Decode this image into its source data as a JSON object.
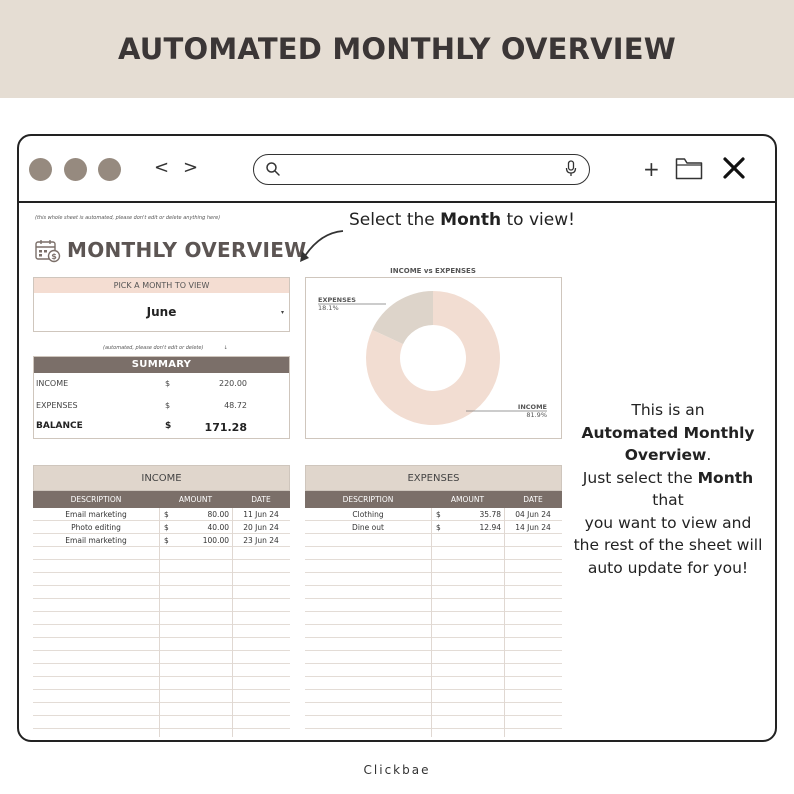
{
  "banner": {
    "title": "AUTOMATED MONTHLY OVERVIEW"
  },
  "browser": {
    "back_label": "<",
    "forward_label": ">",
    "plus_label": "+",
    "search_placeholder": ""
  },
  "sheet": {
    "automated_note": "(this whole sheet is automated, please don't edit or delete anything here)",
    "title": "MONTHLY OVERVIEW",
    "callout": {
      "pre": "Select the ",
      "bold": "Month",
      "post": " to view!"
    },
    "picker": {
      "label": "PICK A MONTH TO VIEW",
      "value": "June",
      "caret": "▾"
    },
    "summary_note": "(automated, please don't edit or delete)",
    "summary_note_arrow": "↓",
    "summary": {
      "title": "SUMMARY",
      "rows": [
        {
          "label": "INCOME",
          "currency": "$",
          "value": "220.00"
        },
        {
          "label": "EXPENSES",
          "currency": "$",
          "value": "48.72"
        },
        {
          "label": "BALANCE",
          "currency": "$",
          "value": "171.28"
        }
      ]
    }
  },
  "chart_data": {
    "type": "pie",
    "title": "INCOME vs EXPENSES",
    "labels": [
      "INCOME",
      "EXPENSES"
    ],
    "values": [
      81.9,
      18.1
    ],
    "value_labels": [
      "81.9%",
      "18.1%"
    ],
    "colors": [
      "#f2ddd2",
      "#ddd4ca"
    ],
    "donut": true
  },
  "right_text": {
    "line1": "This is an",
    "line2": "Automated Monthly",
    "line3": "Overview",
    "line3_end": ".",
    "line4_pre": "Just select the ",
    "line4_bold": "Month",
    "line4_post": " that",
    "line5": "you want to view and",
    "line6": "the rest of the sheet will",
    "line7": "auto update for you!"
  },
  "income_table": {
    "title": "INCOME",
    "headers": [
      "DESCRIPTION",
      "AMOUNT",
      "DATE"
    ],
    "rows": [
      {
        "description": "Email marketing",
        "currency": "$",
        "amount": "80.00",
        "date": "11 Jun 24"
      },
      {
        "description": "Photo editing",
        "currency": "$",
        "amount": "40.00",
        "date": "20 Jun 24"
      },
      {
        "description": "Email marketing",
        "currency": "$",
        "amount": "100.00",
        "date": "23 Jun 24"
      }
    ]
  },
  "expenses_table": {
    "title": "EXPENSES",
    "headers": [
      "DESCRIPTION",
      "AMOUNT",
      "DATE"
    ],
    "rows": [
      {
        "description": "Clothing",
        "currency": "$",
        "amount": "35.78",
        "date": "04 Jun 24"
      },
      {
        "description": "Dine out",
        "currency": "$",
        "amount": "12.94",
        "date": "14 Jun 24"
      }
    ]
  },
  "footer": {
    "brand": "Clickbae"
  }
}
